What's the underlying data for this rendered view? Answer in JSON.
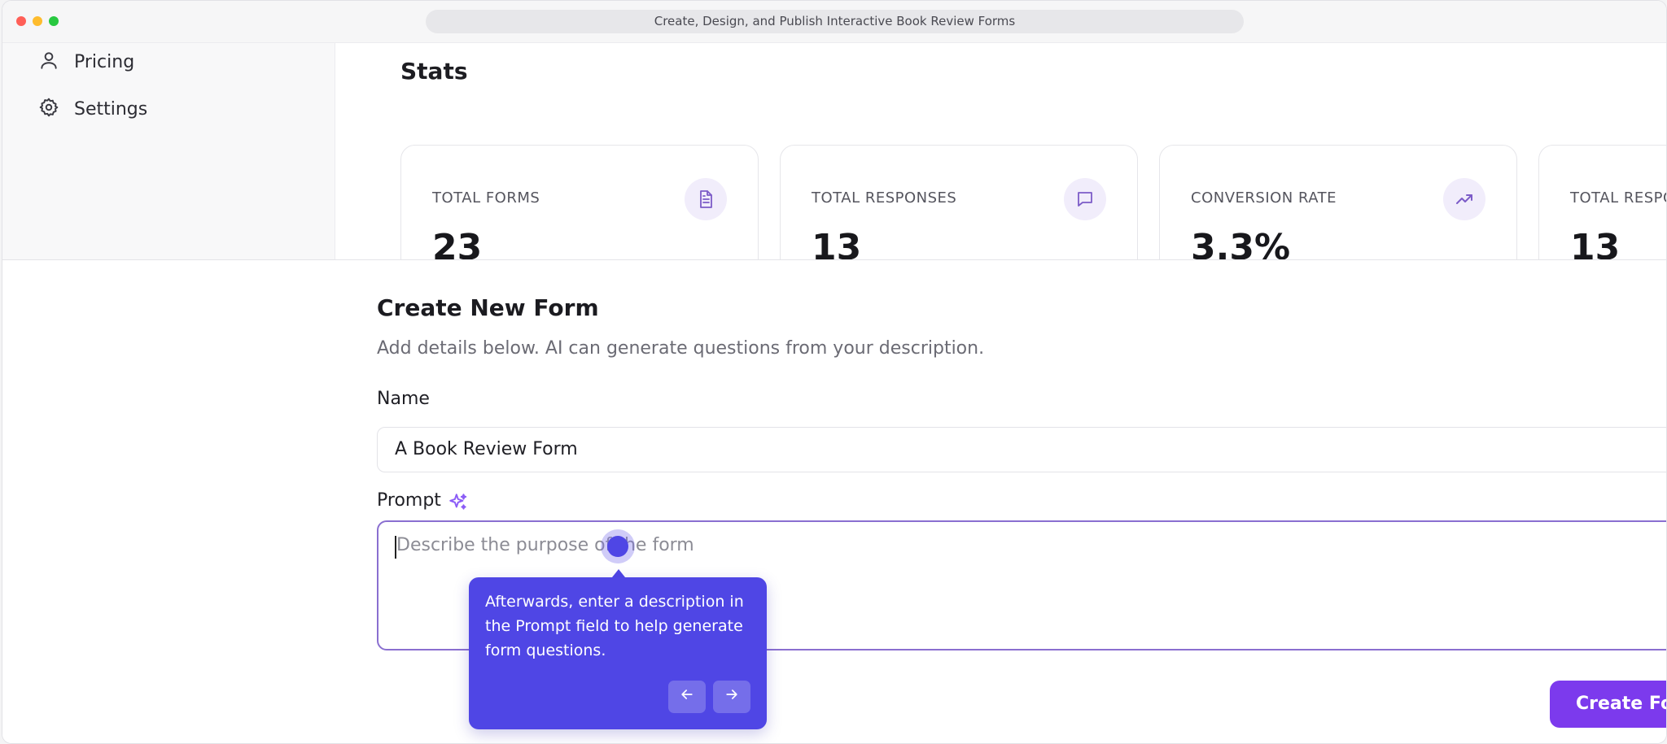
{
  "window": {
    "url_title": "Create, Design, and Publish Interactive Book Review Forms"
  },
  "sidebar": {
    "items": [
      {
        "label": "Pricing",
        "icon": "user-icon"
      },
      {
        "label": "Settings",
        "icon": "gear-icon"
      }
    ]
  },
  "stats": {
    "title": "Stats",
    "cards": [
      {
        "label": "TOTAL FORMS",
        "value": "23",
        "icon": "document-icon"
      },
      {
        "label": "TOTAL RESPONSES",
        "value": "13",
        "icon": "chat-icon"
      },
      {
        "label": "CONVERSION RATE",
        "value": "3.3%",
        "icon": "trending-up-icon"
      },
      {
        "label": "TOTAL RESPO",
        "value": "13",
        "icon": ""
      }
    ]
  },
  "form": {
    "title": "Create New Form",
    "description": "Add details below. AI can generate questions from your description.",
    "name_label": "Name",
    "name_value": "A Book Review Form",
    "prompt_label": "Prompt",
    "prompt_placeholder": "Describe the purpose of the form",
    "create_label": "Create Form"
  },
  "tooltip": {
    "text": "Afterwards, enter a description in the Prompt field to help generate form questions.",
    "prev_icon": "arrow-left-icon",
    "next_icon": "arrow-right-icon"
  },
  "colors": {
    "accent": "#4f46e5",
    "primary_button": "#7c3aed",
    "icon_purple": "#7c5cc8"
  }
}
